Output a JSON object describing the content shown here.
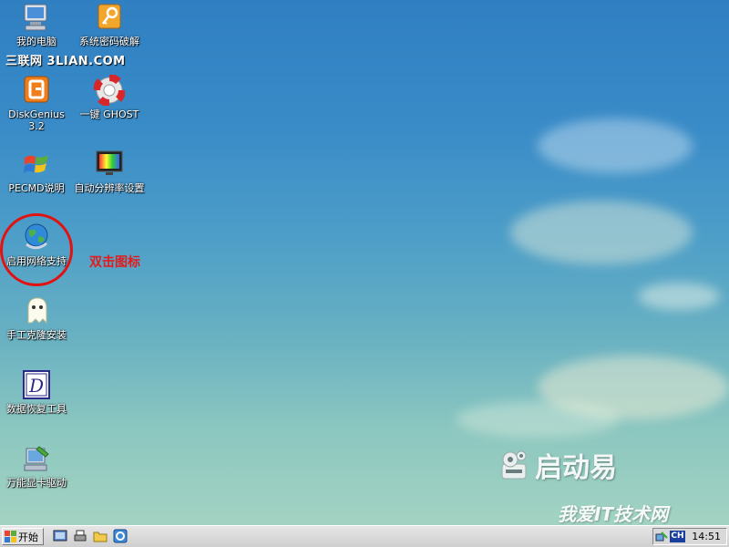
{
  "desktop": {
    "watermark": "三联网 3LIAN.COM",
    "annotation": "双击图标",
    "brand_text": "启动易",
    "site_watermark": "我爱IT技术网",
    "icons": [
      {
        "label": "我的电脑",
        "icon": "my-computer-icon"
      },
      {
        "label": "系统密码破解",
        "icon": "key-icon"
      },
      {
        "label": "DiskGenius 3.2",
        "icon": "diskgenius-icon"
      },
      {
        "label": "一键 GHOST",
        "icon": "lifebuoy-icon"
      },
      {
        "label": "PECMD说明",
        "icon": "windows-flag-icon"
      },
      {
        "label": "自动分辨率设置",
        "icon": "monitor-icon"
      },
      {
        "label": "启用网络支持",
        "icon": "network-globe-icon"
      },
      {
        "label": "手工克隆安装",
        "icon": "ghost-icon"
      },
      {
        "label": "数据恢复工具",
        "icon": "data-recovery-icon"
      },
      {
        "label": "万能显卡驱动",
        "icon": "display-driver-icon"
      }
    ]
  },
  "taskbar": {
    "start_label": "开始",
    "ime": "CH",
    "clock": "14:51"
  },
  "colors": {
    "annotation": "#e41b1b",
    "taskbar": "#d8d8d8"
  }
}
